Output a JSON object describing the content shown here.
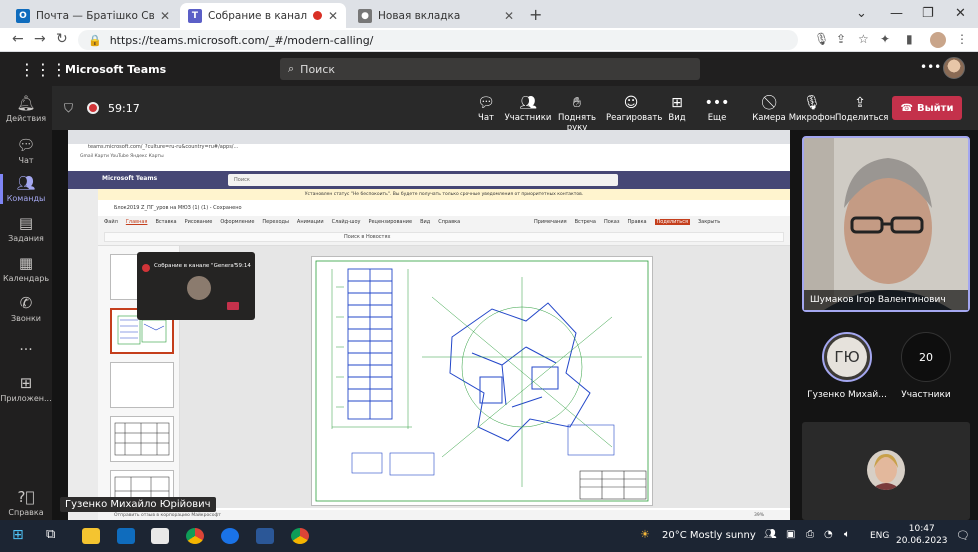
{
  "browser": {
    "tabs": [
      {
        "title": "Почта — Братішко Світлана Ми...",
        "icon": "outlook-icon",
        "color": "#0f6cbd"
      },
      {
        "title": "Собрание в канале \"Genera",
        "icon": "teams-icon",
        "color": "#5b5fc7"
      },
      {
        "title": "Новая вкладка",
        "icon": "chrome-icon",
        "color": "#888888"
      }
    ],
    "url": "https://teams.microsoft.com/_#/modern-calling/"
  },
  "teams": {
    "brand": "Microsoft Teams",
    "search_placeholder": "Поиск",
    "rail": [
      {
        "label": "Действия",
        "icon": "bell-icon"
      },
      {
        "label": "Чат",
        "icon": "chat-icon"
      },
      {
        "label": "Команды",
        "icon": "teams-people-icon"
      },
      {
        "label": "Задания",
        "icon": "assignments-icon"
      },
      {
        "label": "Календарь",
        "icon": "calendar-icon"
      },
      {
        "label": "Звонки",
        "icon": "phone-icon"
      },
      {
        "label": "...",
        "icon": "more-icon"
      },
      {
        "label": "Приложен...",
        "icon": "apps-icon"
      },
      {
        "label": "Справка",
        "icon": "help-icon"
      }
    ]
  },
  "meeting": {
    "timer": "59:17",
    "controls": [
      {
        "label": "Чат",
        "icon": "chat-icon"
      },
      {
        "label": "Участники",
        "icon": "participants-icon"
      },
      {
        "label": "Поднять руку",
        "icon": "hand-icon"
      },
      {
        "label": "Реагировать",
        "icon": "smile-icon"
      },
      {
        "label": "Вид",
        "icon": "view-icon"
      },
      {
        "label": "Еще",
        "icon": "more-icon"
      },
      {
        "label": "Камера",
        "icon": "camera-off-icon"
      },
      {
        "label": "Микрофон",
        "icon": "mic-off-icon"
      },
      {
        "label": "Поделиться",
        "icon": "share-icon"
      }
    ],
    "leave_label": "Выйти",
    "presenter_name": "Гузенко Михайло Юрійович",
    "participants": {
      "main_video_name": "Шумаков Ігор Валентинович",
      "initials": "ГЮ",
      "avatar_name": "Гузенко Михай...",
      "count": "20",
      "count_label": "Участники"
    }
  },
  "shared_screen": {
    "url": "teams.microsoft.com/_?culture=ru-ru&country=ru#/apps/...",
    "bookmarks": "Gmail   Карти   YouTube   Яндекс   Карты",
    "inner_brand": "Microsoft Teams",
    "inner_search": "Поиск",
    "warning": "Установлен статус \"Не беспокоить\". Вы будете получать только срочные уведомления от приоритетных контактов.",
    "doc_title": "Блок2019 Z_ПГ_уров на МЮЗ (1) (1) - Сохранено",
    "ribbon_tabs": [
      "Файл",
      "Главная",
      "Вставка",
      "Рисование",
      "Оформление",
      "Переходы",
      "Анимации",
      "Слайд-шоу",
      "Рецензирование",
      "Вид",
      "Справка"
    ],
    "ribbon_right": [
      "Примечания",
      "Встреча",
      "Показ",
      "Правка",
      "Поделиться",
      "Закрыть"
    ],
    "search_hint": "Поиск в Новостях",
    "mini_title": "Собрание в канале \"Genera\"",
    "mini_timer": "59:14",
    "status": "Отправить отзыв в корпорацию Майкрософт",
    "zoom": "39%"
  },
  "taskbar": {
    "weather": "20°C  Mostly sunny",
    "lang": "ENG",
    "time": "10:47",
    "date": "20.06.2023"
  }
}
